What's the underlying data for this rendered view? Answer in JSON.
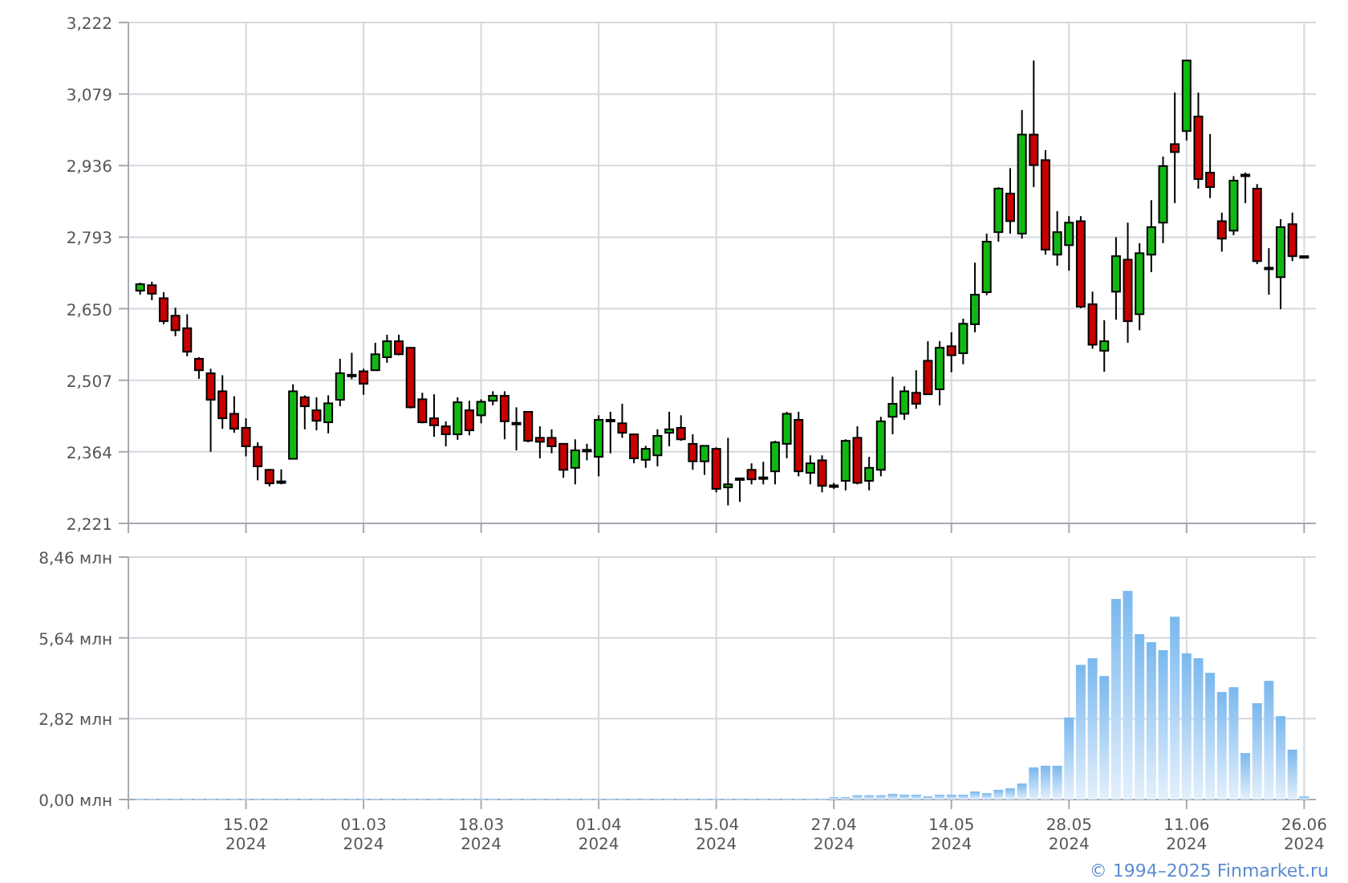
{
  "price_chart": {
    "chart_data": {
      "type": "candlestick",
      "grid": true,
      "ylim": [
        2221,
        3222
      ],
      "categories": [
        null,
        null,
        null,
        null,
        null,
        null,
        null,
        null,
        null,
        null,
        null,
        null,
        null,
        null,
        null,
        null,
        null,
        null,
        null,
        null,
        null,
        null,
        null,
        null,
        null,
        null,
        null,
        null,
        null,
        null,
        null,
        null,
        null,
        null,
        null,
        null,
        null,
        null,
        null,
        null,
        null,
        null,
        null,
        null,
        null,
        null,
        null,
        null,
        null,
        null,
        null,
        null,
        null,
        null,
        null,
        null,
        null,
        null,
        null,
        null,
        null,
        null,
        null,
        null,
        null,
        null,
        null,
        null,
        null,
        null,
        null,
        null,
        null,
        null,
        null,
        null,
        null,
        null,
        null,
        null,
        null,
        null,
        null,
        null,
        null,
        null,
        null,
        null,
        null,
        null,
        null,
        null,
        null,
        null,
        null,
        null,
        null,
        null,
        null,
        null
      ],
      "yticks": [
        {
          "value": 2221,
          "label": "2,221"
        },
        {
          "value": 2364,
          "label": "2,364"
        },
        {
          "value": 2507,
          "label": "2,507"
        },
        {
          "value": 2650,
          "label": "2,650"
        },
        {
          "value": 2793,
          "label": "2,793"
        },
        {
          "value": 2936,
          "label": "2,936"
        },
        {
          "value": 3079,
          "label": "3,079"
        },
        {
          "value": 3222,
          "label": "3,222"
        }
      ],
      "ohlc": [
        [
          2686,
          2702,
          2678,
          2699
        ],
        [
          2697,
          2704,
          2667,
          2680
        ],
        [
          2671,
          2683,
          2619,
          2625
        ],
        [
          2636,
          2652,
          2595,
          2607
        ],
        [
          2611,
          2639,
          2555,
          2564
        ],
        [
          2550,
          2553,
          2510,
          2527
        ],
        [
          2521,
          2530,
          2364,
          2468
        ],
        [
          2485,
          2517,
          2410,
          2431
        ],
        [
          2440,
          2475,
          2402,
          2410
        ],
        [
          2412,
          2431,
          2355,
          2375
        ],
        [
          2374,
          2383,
          2307,
          2335
        ],
        [
          2328,
          2330,
          2295,
          2301
        ],
        [
          2305,
          2329,
          2299,
          2303
        ],
        [
          2350,
          2499,
          2350,
          2485
        ],
        [
          2473,
          2477,
          2409,
          2455
        ],
        [
          2447,
          2473,
          2407,
          2426
        ],
        [
          2423,
          2477,
          2401,
          2461
        ],
        [
          2468,
          2550,
          2455,
          2521
        ],
        [
          2515,
          2562,
          2509,
          2518
        ],
        [
          2525,
          2530,
          2478,
          2500
        ],
        [
          2527,
          2582,
          2527,
          2559
        ],
        [
          2553,
          2598,
          2542,
          2585
        ],
        [
          2585,
          2598,
          2557,
          2559
        ],
        [
          2572,
          2572,
          2451,
          2453
        ],
        [
          2469,
          2482,
          2421,
          2423
        ],
        [
          2431,
          2479,
          2394,
          2417
        ],
        [
          2415,
          2425,
          2375,
          2399
        ],
        [
          2399,
          2473,
          2388,
          2463
        ],
        [
          2447,
          2466,
          2397,
          2407
        ],
        [
          2437,
          2469,
          2421,
          2464
        ],
        [
          2466,
          2485,
          2457,
          2476
        ],
        [
          2476,
          2485,
          2389,
          2425
        ],
        [
          2422,
          2453,
          2367,
          2420
        ],
        [
          2444,
          2444,
          2383,
          2386
        ],
        [
          2392,
          2415,
          2351,
          2384
        ],
        [
          2392,
          2409,
          2361,
          2375
        ],
        [
          2380,
          2380,
          2312,
          2328
        ],
        [
          2332,
          2389,
          2299,
          2367
        ],
        [
          2366,
          2380,
          2347,
          2368
        ],
        [
          2354,
          2437,
          2315,
          2428
        ],
        [
          2428,
          2444,
          2361,
          2425
        ],
        [
          2421,
          2460,
          2392,
          2402
        ],
        [
          2399,
          2399,
          2341,
          2351
        ],
        [
          2348,
          2376,
          2332,
          2370
        ],
        [
          2357,
          2409,
          2335,
          2396
        ],
        [
          2402,
          2444,
          2375,
          2409
        ],
        [
          2412,
          2437,
          2386,
          2389
        ],
        [
          2380,
          2399,
          2328,
          2345
        ],
        [
          2345,
          2376,
          2318,
          2376
        ],
        [
          2370,
          2373,
          2283,
          2290
        ],
        [
          2293,
          2392,
          2257,
          2299
        ],
        [
          2309,
          2312,
          2264,
          2311
        ],
        [
          2328,
          2341,
          2299,
          2309
        ],
        [
          2311,
          2344,
          2299,
          2313
        ],
        [
          2325,
          2386,
          2299,
          2383
        ],
        [
          2380,
          2444,
          2351,
          2440
        ],
        [
          2428,
          2444,
          2315,
          2325
        ],
        [
          2322,
          2357,
          2299,
          2341
        ],
        [
          2347,
          2357,
          2283,
          2296
        ],
        [
          2297,
          2302,
          2290,
          2296
        ],
        [
          2306,
          2389,
          2287,
          2386
        ],
        [
          2392,
          2415,
          2299,
          2302
        ],
        [
          2306,
          2354,
          2287,
          2332
        ],
        [
          2328,
          2434,
          2315,
          2425
        ],
        [
          2434,
          2514,
          2399,
          2460
        ],
        [
          2440,
          2495,
          2428,
          2485
        ],
        [
          2482,
          2527,
          2450,
          2460
        ],
        [
          2546,
          2585,
          2479,
          2479
        ],
        [
          2489,
          2585,
          2457,
          2572
        ],
        [
          2575,
          2603,
          2523,
          2557
        ],
        [
          2561,
          2630,
          2539,
          2620
        ],
        [
          2619,
          2742,
          2603,
          2678
        ],
        [
          2683,
          2800,
          2677,
          2784
        ],
        [
          2803,
          2893,
          2784,
          2890
        ],
        [
          2880,
          2931,
          2800,
          2825
        ],
        [
          2800,
          3047,
          2790,
          2998
        ],
        [
          2998,
          3146,
          2893,
          2937
        ],
        [
          2947,
          2967,
          2758,
          2768
        ],
        [
          2758,
          2845,
          2736,
          2803
        ],
        [
          2777,
          2835,
          2726,
          2822
        ],
        [
          2825,
          2835,
          2651,
          2654
        ],
        [
          2659,
          2684,
          2570,
          2578
        ],
        [
          2566,
          2627,
          2524,
          2585
        ],
        [
          2684,
          2793,
          2628,
          2755
        ],
        [
          2748,
          2822,
          2582,
          2625
        ],
        [
          2639,
          2781,
          2607,
          2761
        ],
        [
          2758,
          2867,
          2723,
          2813
        ],
        [
          2822,
          2954,
          2781,
          2935
        ],
        [
          2979,
          3082,
          2861,
          2963
        ],
        [
          3005,
          3146,
          2986,
          3146
        ],
        [
          3034,
          3082,
          2890,
          2909
        ],
        [
          2922,
          2999,
          2871,
          2893
        ],
        [
          2825,
          2842,
          2764,
          2790
        ],
        [
          2806,
          2915,
          2797,
          2906
        ],
        [
          2918,
          2922,
          2861,
          2916
        ],
        [
          2890,
          2899,
          2739,
          2745
        ],
        [
          2732,
          2771,
          2678,
          2729
        ],
        [
          2713,
          2829,
          2649,
          2813
        ],
        [
          2819,
          2842,
          2745,
          2755
        ],
        [
          2755,
          2755,
          2754,
          2754
        ]
      ]
    }
  },
  "volume_chart": {
    "chart_data": {
      "type": "bar",
      "grid": true,
      "ylim": [
        0,
        8.46
      ],
      "categories": [
        null,
        null,
        null,
        null,
        null,
        null,
        null,
        null,
        null,
        "15.02 2024",
        null,
        null,
        null,
        null,
        null,
        null,
        null,
        null,
        null,
        "01.03 2024",
        null,
        null,
        null,
        null,
        null,
        null,
        null,
        null,
        null,
        "18.03 2024",
        null,
        null,
        null,
        null,
        null,
        null,
        null,
        null,
        null,
        "01.04 2024",
        null,
        null,
        null,
        null,
        null,
        null,
        null,
        null,
        null,
        "15.04 2024",
        null,
        null,
        null,
        null,
        null,
        null,
        null,
        null,
        null,
        "27.04 2024",
        null,
        null,
        null,
        null,
        null,
        null,
        null,
        null,
        null,
        "14.05 2024",
        null,
        null,
        null,
        null,
        null,
        null,
        null,
        null,
        null,
        "28.05 2024",
        null,
        null,
        null,
        null,
        null,
        null,
        null,
        null,
        null,
        "11.06 2024",
        null,
        null,
        null,
        null,
        null,
        null,
        null,
        null,
        null,
        "26.06 2024"
      ],
      "yticks": [
        {
          "value": 0,
          "label": "0,00 млн"
        },
        {
          "value": 2.82,
          "label": "2,82 млн"
        },
        {
          "value": 5.64,
          "label": "5,64 млн"
        },
        {
          "value": 8.46,
          "label": "8,46 млн"
        }
      ],
      "series": [
        {
          "color": "#7ab8ee",
          "values": [
            0.03,
            0.03,
            0.03,
            0.03,
            0.03,
            0.03,
            0.03,
            0.03,
            0.03,
            0.03,
            0.03,
            0.03,
            0.03,
            0.03,
            0.03,
            0.03,
            0.03,
            0.03,
            0.03,
            0.03,
            0.03,
            0.03,
            0.03,
            0.03,
            0.03,
            0.03,
            0.03,
            0.03,
            0.03,
            0.03,
            0.03,
            0.03,
            0.03,
            0.03,
            0.03,
            0.03,
            0.03,
            0.03,
            0.03,
            0.03,
            0.03,
            0.03,
            0.03,
            0.03,
            0.03,
            0.03,
            0.03,
            0.03,
            0.03,
            0.03,
            0.03,
            0.03,
            0.03,
            0.03,
            0.03,
            0.03,
            0.03,
            0.03,
            0.03,
            0.08,
            0.08,
            0.15,
            0.15,
            0.15,
            0.2,
            0.17,
            0.17,
            0.11,
            0.17,
            0.17,
            0.17,
            0.28,
            0.22,
            0.34,
            0.39,
            0.56,
            1.12,
            1.18,
            1.18,
            2.86,
            4.7,
            4.93,
            4.31,
            7.0,
            7.28,
            5.77,
            5.49,
            5.21,
            6.38,
            5.1,
            4.93,
            4.42,
            3.75,
            3.92,
            1.62,
            3.36,
            4.14,
            2.91,
            1.74,
            0.11
          ]
        }
      ]
    }
  },
  "footer": {
    "copyright": "© 1994–2025 Finmarket.ru"
  }
}
